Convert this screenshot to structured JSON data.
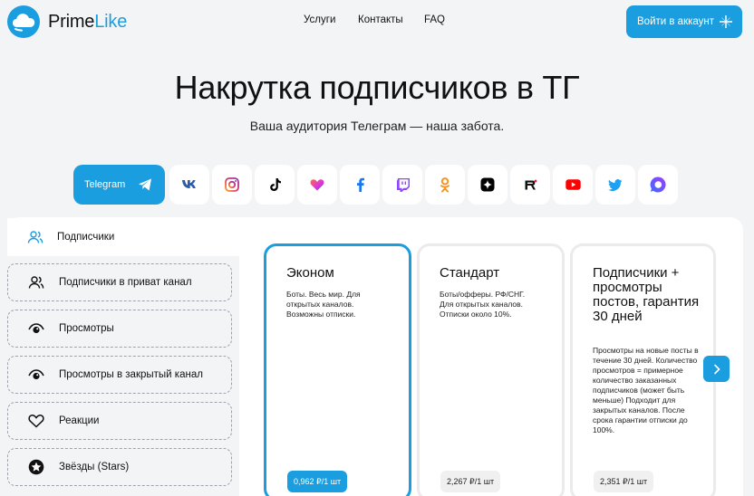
{
  "brand": {
    "part1": "Prime",
    "part2": "Like",
    "accent": "#1a9ee0"
  },
  "nav": {
    "services": "Услуги",
    "contacts": "Контакты",
    "faq": "FAQ"
  },
  "login": {
    "label": "Войти в аккаунт",
    "icon": "plus-icon"
  },
  "hero": {
    "title": "Накрутка подписчиков в ТГ",
    "subtitle": "Ваша аудитория Телеграм — наша забота."
  },
  "socials": {
    "active": {
      "label": "Telegram",
      "icon": "telegram-icon"
    },
    "items": [
      "vk-icon",
      "instagram-icon",
      "tiktok-icon",
      "likee-icon",
      "facebook-icon",
      "twitch-icon",
      "odnoklassniki-icon",
      "dzen-icon",
      "rutube-icon",
      "youtube-icon",
      "twitter-icon",
      "max-icon"
    ]
  },
  "sidebar": {
    "selected": {
      "label": "Подписчики",
      "icon": "users-icon"
    },
    "items": [
      {
        "label": "Подписчики в приват канал",
        "icon": "users-icon"
      },
      {
        "label": "Просмотры",
        "icon": "eye-icon"
      },
      {
        "label": "Просмотры в закрытый канал",
        "icon": "eye-icon"
      },
      {
        "label": "Реакции",
        "icon": "heart-icon"
      },
      {
        "label": "Звёзды (Stars)",
        "icon": "star-icon"
      }
    ]
  },
  "cards": [
    {
      "title": "Эконом",
      "desc": "Боты. Весь мир. Для открытых каналов. Возможны отписки.",
      "price": "0,962 ₽/1 шт",
      "active": true
    },
    {
      "title": "Стандарт",
      "desc": "Боты/офферы. РФ/СНГ. Для открытых каналов. Отписки около 10%.",
      "price": "2,267 ₽/1 шт",
      "active": false
    },
    {
      "title": "Подписчики + просмотры постов, гарантия 30 дней",
      "desc": "Просмотры на новые посты в течение 30 дней. Количество просмотров = примерное количество заказанных подписчиков (может быть меньше) Подходит для закрытых каналов. После срока гарантии отписки до 100%.",
      "price": "2,351 ₽/1 шт",
      "active": false
    }
  ],
  "carousel": {
    "next_icon": "chevron-right-icon"
  }
}
